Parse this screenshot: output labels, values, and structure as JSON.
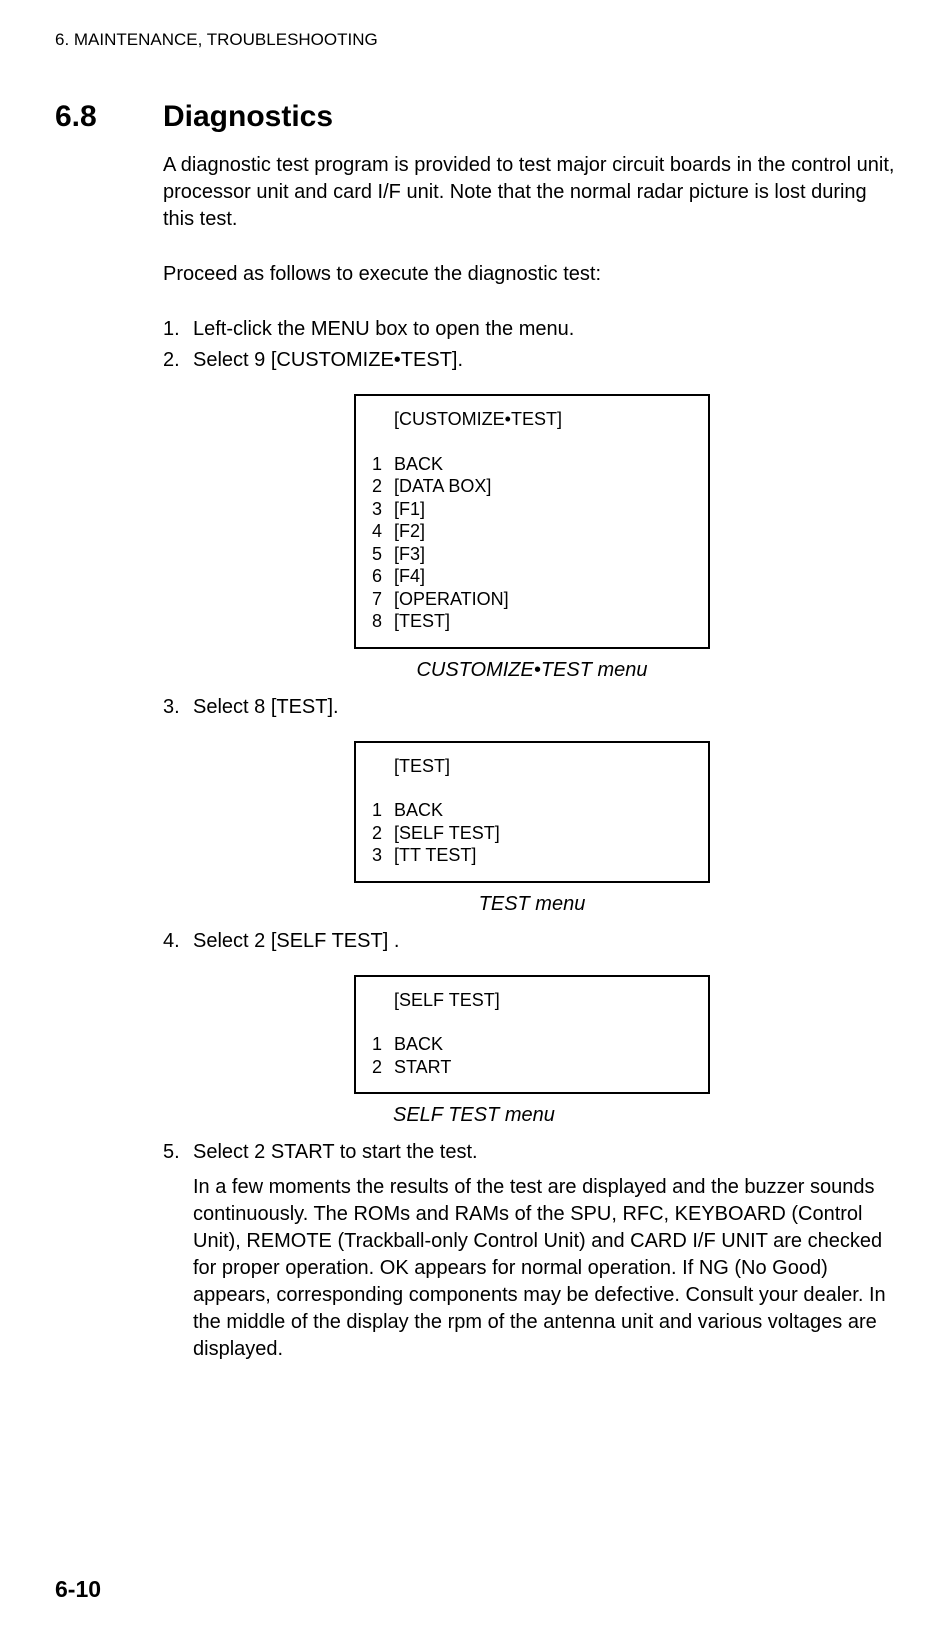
{
  "header": "6. MAINTENANCE, TROUBLESHOOTING",
  "section": {
    "number": "6.8",
    "title": "Diagnostics",
    "intro": "A diagnostic test program is provided to test major circuit boards in the control unit, processor unit and card I/F unit. Note that the normal radar picture is lost during this test.",
    "proceed": "Proceed as follows to execute the diagnostic test:"
  },
  "steps": {
    "s1": {
      "num": "1.",
      "text": "Left-click the MENU box to open the menu."
    },
    "s2": {
      "num": "2.",
      "text": "Select 9 [CUSTOMIZE•TEST]."
    },
    "s3": {
      "num": "3.",
      "text": "Select 8 [TEST]."
    },
    "s4": {
      "num": "4.",
      "text": "Select 2 [SELF TEST] ."
    },
    "s5": {
      "num": "5.",
      "text": "Select 2 START to start the test."
    }
  },
  "menu1": {
    "title": "[CUSTOMIZE•TEST]",
    "items": [
      {
        "n": "1",
        "label": "BACK"
      },
      {
        "n": "2",
        "label": "[DATA BOX]"
      },
      {
        "n": "3",
        "label": "[F1]"
      },
      {
        "n": "4",
        "label": "[F2]"
      },
      {
        "n": "5",
        "label": "[F3]"
      },
      {
        "n": "6",
        "label": "[F4]"
      },
      {
        "n": "7",
        "label": "[OPERATION]"
      },
      {
        "n": "8",
        "label": "[TEST]"
      }
    ],
    "caption": "CUSTOMIZE•TEST menu"
  },
  "menu2": {
    "title": "[TEST]",
    "items": [
      {
        "n": "1",
        "label": "BACK"
      },
      {
        "n": "2",
        "label": "[SELF TEST]"
      },
      {
        "n": "3",
        "label": "[TT TEST]"
      }
    ],
    "caption": "TEST menu"
  },
  "menu3": {
    "title": "[SELF TEST]",
    "items": [
      {
        "n": "1",
        "label": "BACK"
      },
      {
        "n": "2",
        "label": "START"
      }
    ],
    "caption": "SELF TEST menu"
  },
  "result": "In a few moments the results of the test are displayed and the buzzer sounds continuously. The ROMs and RAMs of the SPU, RFC, KEYBOARD (Control Unit), REMOTE (Trackball-only Control Unit) and CARD I/F UNIT are checked for proper operation. OK appears for normal operation. If NG (No Good) appears, corresponding components may be defective. Consult your dealer. In the middle of the display the rpm of the antenna unit and various voltages are displayed.",
  "page_number": "6-10"
}
